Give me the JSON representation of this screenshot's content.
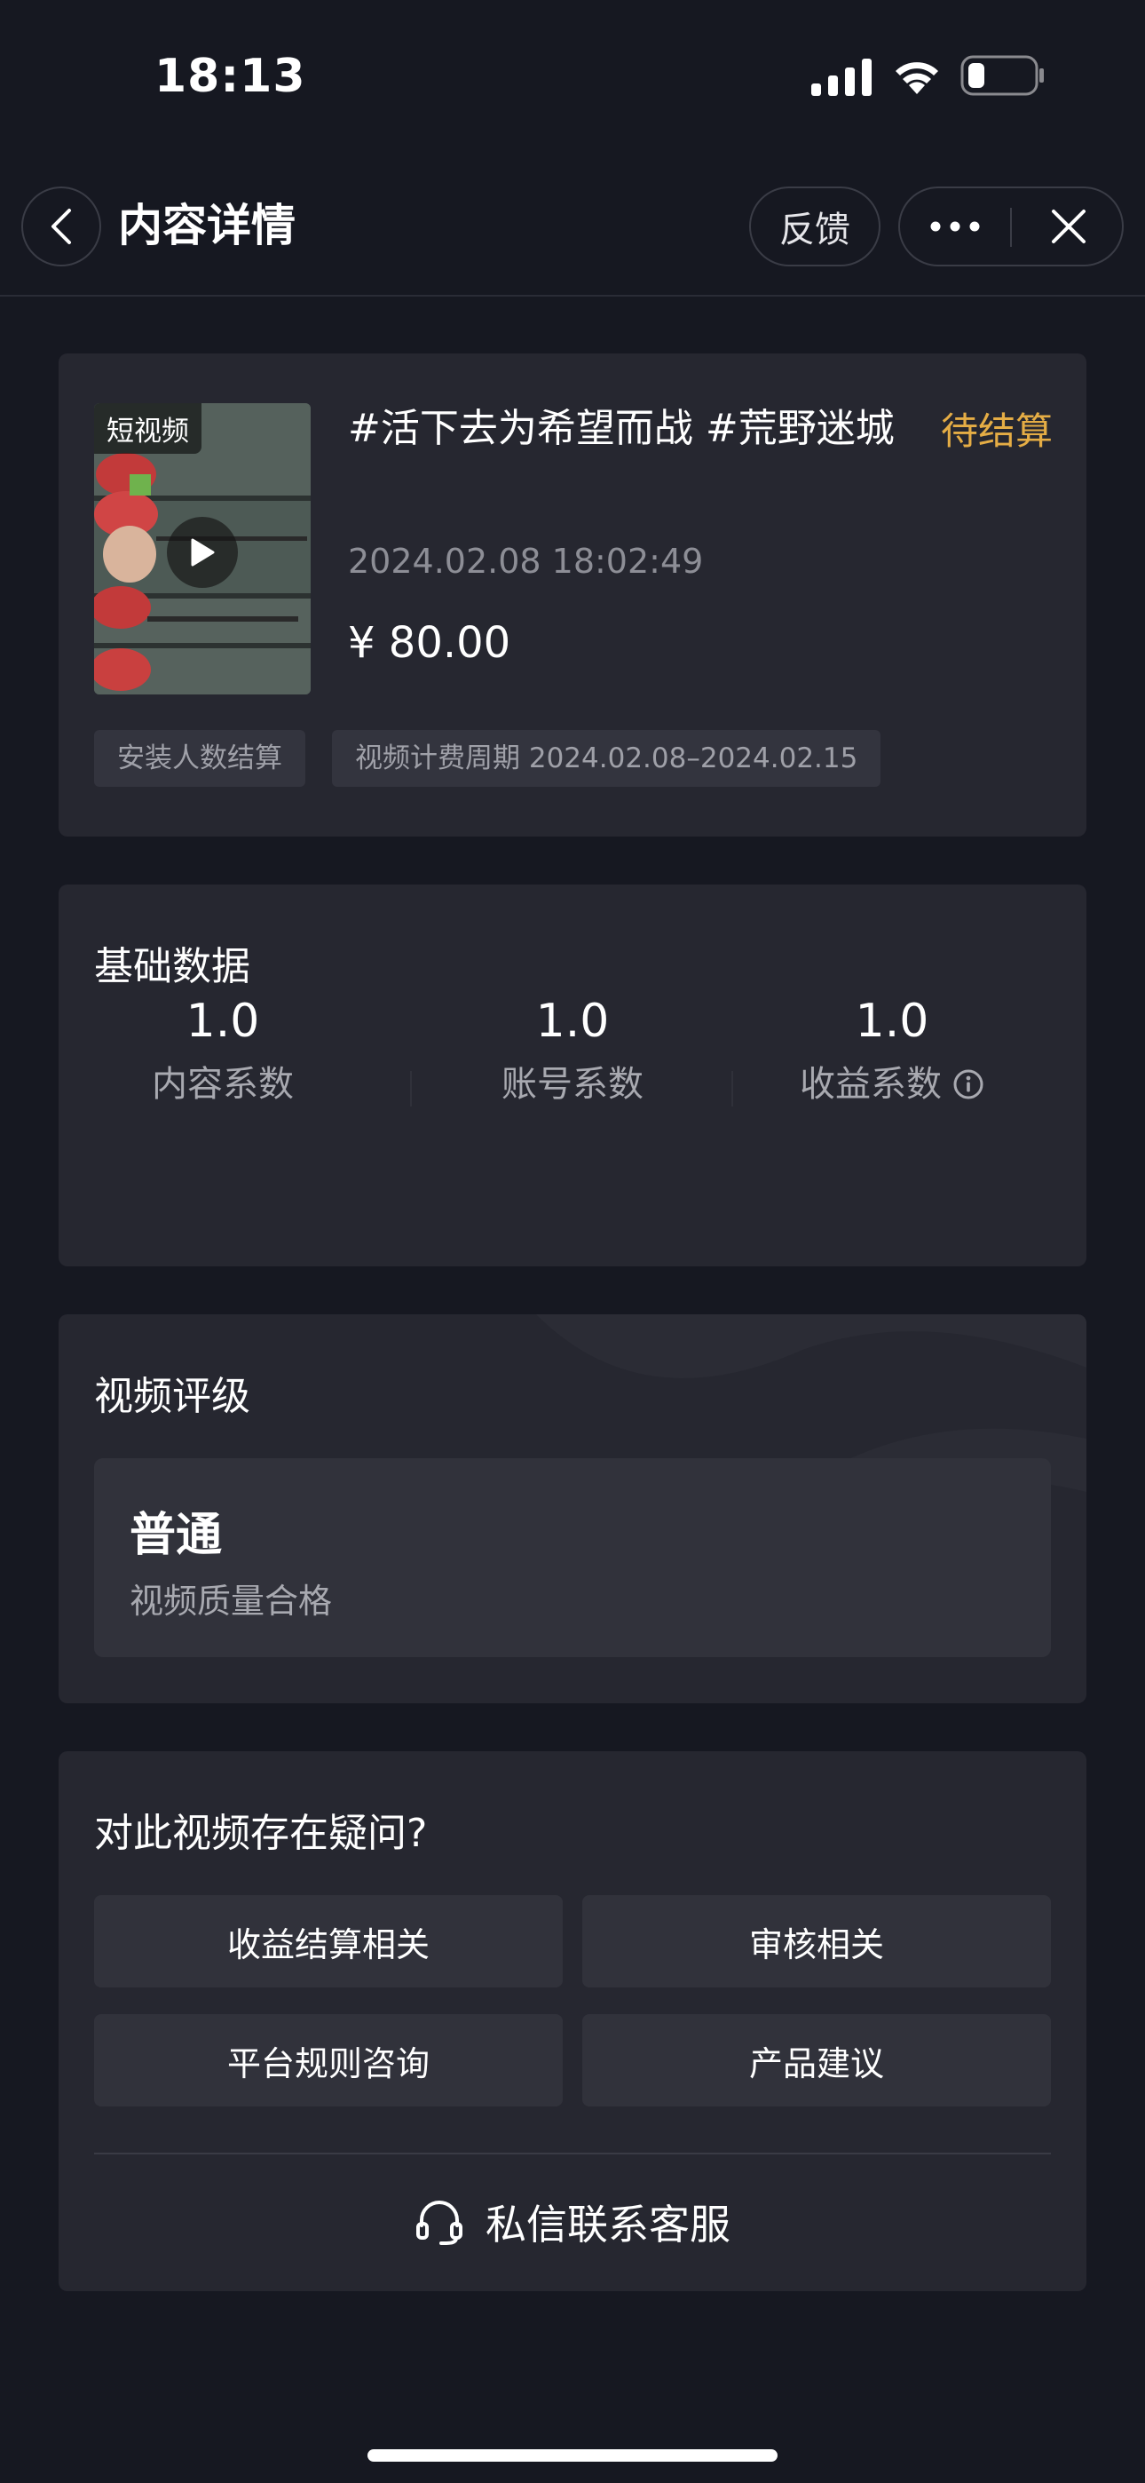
{
  "status_bar": {
    "time": "18:13"
  },
  "nav": {
    "title": "内容详情",
    "feedback_label": "反馈"
  },
  "video": {
    "type_tag": "短视频",
    "title": "#活下去为希望而战 #荒野迷城",
    "status": "待结算",
    "time": "2024.02.08 18:02:49",
    "price": "¥ 80.00",
    "tags": [
      "安装人数结算",
      "视频计费周期 2024.02.08–2024.02.15"
    ]
  },
  "basic_data": {
    "title": "基础数据",
    "metrics": [
      {
        "value": "1.0",
        "label": "内容系数"
      },
      {
        "value": "1.0",
        "label": "账号系数"
      },
      {
        "value": "1.0",
        "label": "收益系数"
      }
    ]
  },
  "rating": {
    "title": "视频评级",
    "level": "普通",
    "description": "视频质量合格"
  },
  "question": {
    "title": "对此视频存在疑问?",
    "buttons": [
      "收益结算相关",
      "审核相关",
      "平台规则咨询",
      "产品建议"
    ],
    "contact_label": "私信联系客服"
  },
  "colors": {
    "background": "#161821",
    "card": "#262730",
    "pending": "#e5ad45"
  }
}
